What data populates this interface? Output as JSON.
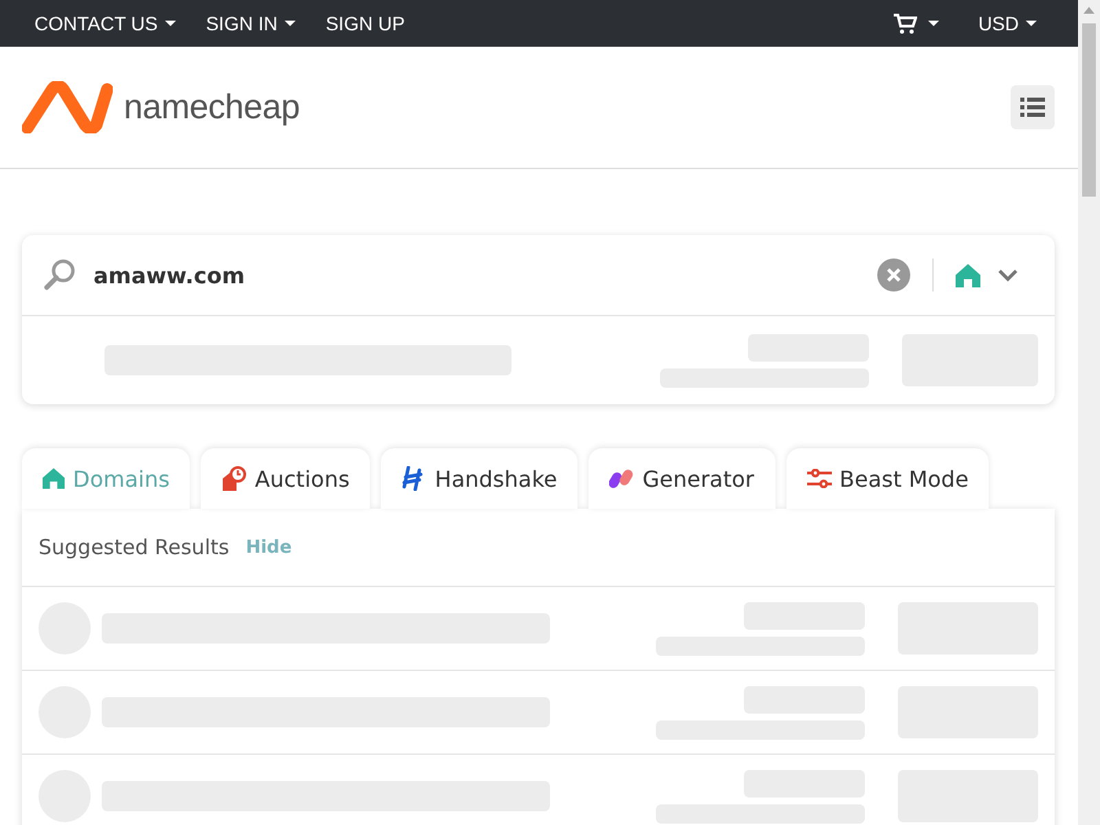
{
  "top_bar": {
    "links": [
      {
        "label": "CONTACT US",
        "dropdown": true
      },
      {
        "label": "SIGN IN",
        "dropdown": true
      },
      {
        "label": "SIGN UP",
        "dropdown": false
      }
    ],
    "currency": "USD"
  },
  "header": {
    "logo_text": "namecheap"
  },
  "search": {
    "value": "amaww.com",
    "results": [
      {
        "kind": "loading"
      }
    ]
  },
  "tabs": [
    {
      "label": "Domains",
      "selected": true
    },
    {
      "label": "Auctions",
      "selected": false
    },
    {
      "label": "Handshake",
      "selected": false
    },
    {
      "label": "Generator",
      "selected": false
    },
    {
      "label": "Beast Mode",
      "selected": false
    }
  ],
  "suggested": {
    "title": "Suggested Results",
    "toggle": "Hide",
    "results": [
      {
        "kind": "loading"
      },
      {
        "kind": "loading"
      },
      {
        "kind": "loading"
      }
    ]
  }
}
